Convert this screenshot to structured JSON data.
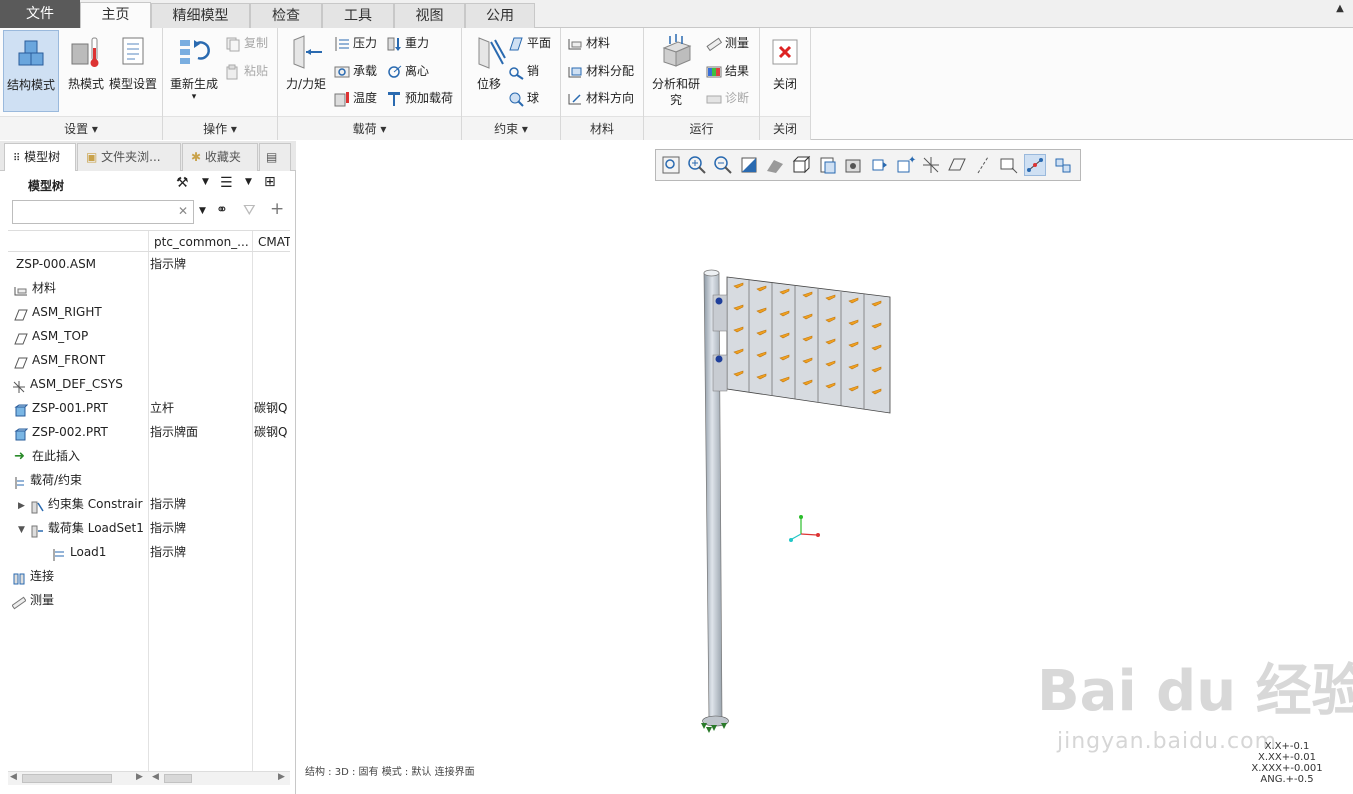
{
  "tabs": [
    {
      "label": "文件"
    },
    {
      "label": "主页"
    },
    {
      "label": "精细模型"
    },
    {
      "label": "检查"
    },
    {
      "label": "工具"
    },
    {
      "label": "视图"
    },
    {
      "label": "公用"
    }
  ],
  "ribbon": {
    "setup": {
      "label": "设置",
      "structural": "结构模式",
      "thermal": "热模式",
      "model_setup": "模型设置"
    },
    "operations": {
      "label": "操作",
      "regenerate": "重新生成",
      "copy": "复制",
      "paste": "粘贴"
    },
    "loads": {
      "label": "载荷",
      "force_moment": "力/力矩",
      "pressure": "压力",
      "gravity": "重力",
      "bearing": "承载",
      "centrifugal": "离心",
      "temperature": "温度",
      "preload": "预加载荷"
    },
    "constraints": {
      "label": "约束",
      "displacement": "位移",
      "planar": "平面",
      "pin": "销",
      "ball": "球"
    },
    "materials": {
      "label": "材料",
      "material": "材料",
      "material_assign": "材料分配",
      "material_orient": "材料方向"
    },
    "run": {
      "label": "运行",
      "analysis": "分析和研究",
      "measure": "测量",
      "results": "结果",
      "diagnose": "诊断"
    },
    "close": {
      "label": "关闭",
      "close": "关闭"
    }
  },
  "panel": {
    "tabs": [
      {
        "label": "模型树"
      },
      {
        "label": "文件夹浏..."
      },
      {
        "label": "收藏夹"
      }
    ],
    "header": "模型树",
    "columns": [
      "ptc_common_...",
      "CMAT"
    ],
    "rows": [
      {
        "name": "ZSP-000.ASM",
        "c2": "指示牌",
        "c3": ""
      },
      {
        "name": "材料",
        "c2": "",
        "c3": ""
      },
      {
        "name": "ASM_RIGHT",
        "c2": "",
        "c3": ""
      },
      {
        "name": "ASM_TOP",
        "c2": "",
        "c3": ""
      },
      {
        "name": "ASM_FRONT",
        "c2": "",
        "c3": ""
      },
      {
        "name": "ASM_DEF_CSYS",
        "c2": "",
        "c3": ""
      },
      {
        "name": "ZSP-001.PRT",
        "c2": "立杆",
        "c3": "碳钢Q"
      },
      {
        "name": "ZSP-002.PRT",
        "c2": "指示牌面",
        "c3": "碳钢Q"
      },
      {
        "name": "在此插入",
        "c2": "",
        "c3": ""
      },
      {
        "name": "载荷/约束",
        "c2": "",
        "c3": ""
      },
      {
        "name": "约束集 Constrair",
        "c2": "指示牌",
        "c3": ""
      },
      {
        "name": "载荷集 LoadSet1",
        "c2": "指示牌",
        "c3": ""
      },
      {
        "name": "Load1",
        "c2": "指示牌",
        "c3": ""
      },
      {
        "name": "连接",
        "c2": "",
        "c3": ""
      },
      {
        "name": "测量",
        "c2": "",
        "c3": ""
      }
    ]
  },
  "viewport": {
    "status": "结构 : 3D : 固有 模式 : 默认 连接界面",
    "tolerances": [
      "X.X+-0.1",
      "X.XX+-0.01",
      "X.XXX+-0.001",
      "ANG.+-0.5"
    ],
    "watermark": "Bai du 经验",
    "watermark_url": "jingyan.baidu.com"
  },
  "colors": {
    "accent": "#cfe0f3",
    "file_tab": "#5a5a5a",
    "load_arrow": "#f0a020",
    "constraint": "#1f3f9a"
  }
}
